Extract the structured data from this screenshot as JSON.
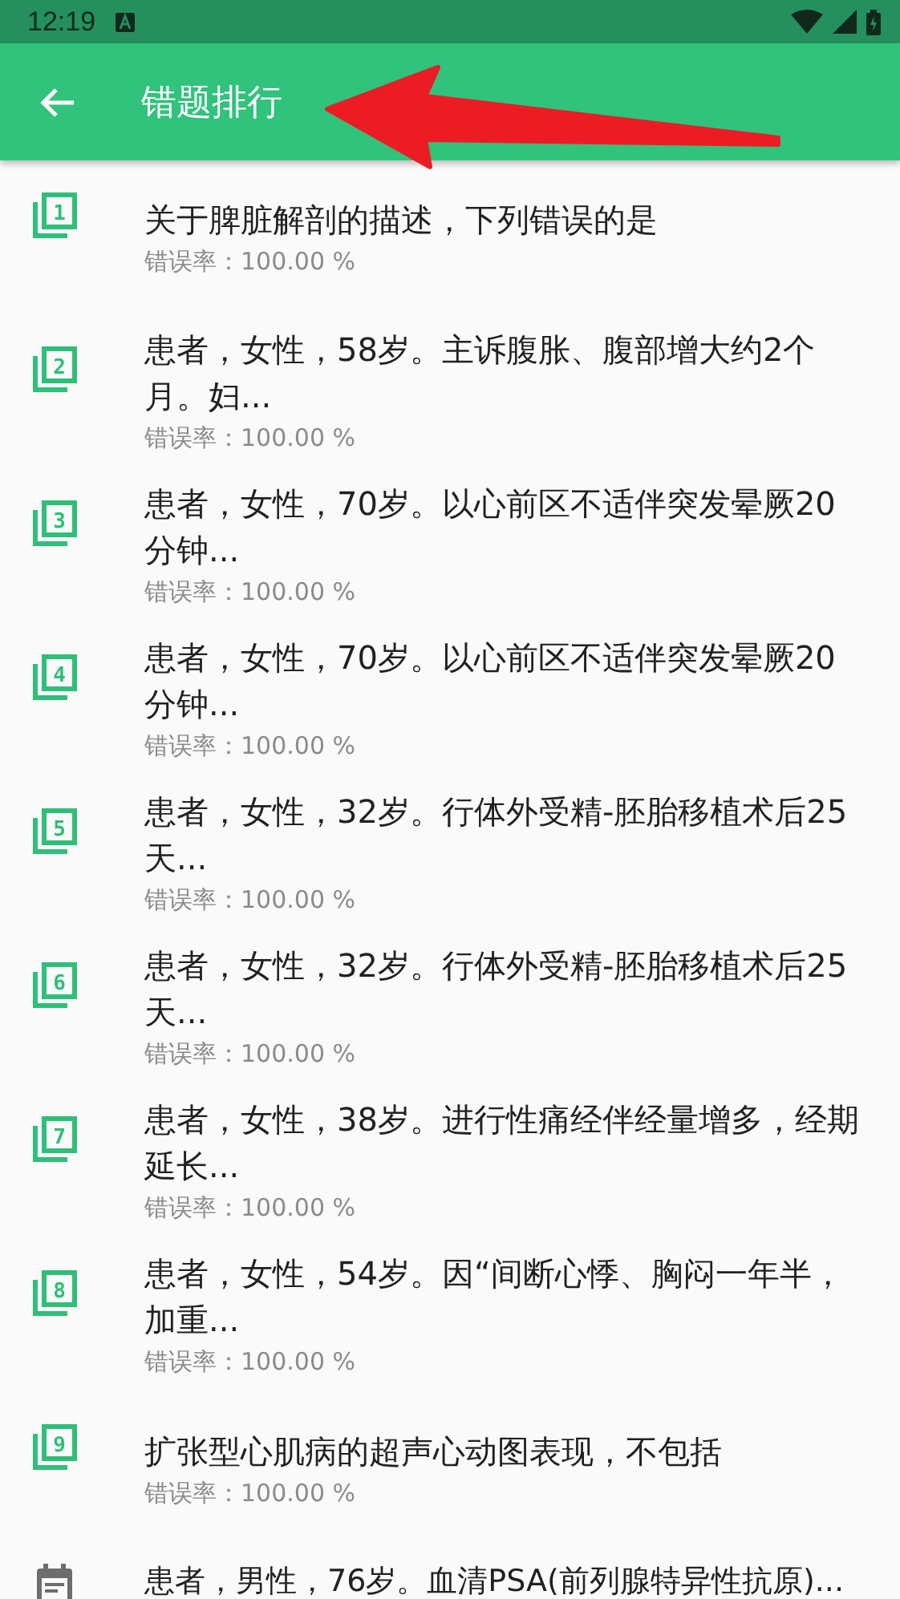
{
  "status_bar": {
    "time": "12:19"
  },
  "app_bar": {
    "title": "错题排行"
  },
  "annotation": {
    "kind": "arrow"
  },
  "items": [
    {
      "kind": "numbered",
      "rank": "1",
      "title": "关于脾脏解剖的描述，下列错误的是",
      "rate": "错误率：100.00 %"
    },
    {
      "kind": "numbered",
      "rank": "2",
      "title": "患者，女性，58岁。主诉腹胀、腹部增大约2个月。妇...",
      "rate": "错误率：100.00 %"
    },
    {
      "kind": "numbered",
      "rank": "3",
      "title": "患者，女性，70岁。以心前区不适伴突发晕厥20分钟...",
      "rate": "错误率：100.00 %"
    },
    {
      "kind": "numbered",
      "rank": "4",
      "title": "患者，女性，70岁。以心前区不适伴突发晕厥20分钟...",
      "rate": "错误率：100.00 %"
    },
    {
      "kind": "numbered",
      "rank": "5",
      "title": "患者，女性，32岁。行体外受精-胚胎移植术后25天...",
      "rate": "错误率：100.00 %"
    },
    {
      "kind": "numbered",
      "rank": "6",
      "title": "患者，女性，32岁。行体外受精-胚胎移植术后25天...",
      "rate": "错误率：100.00 %"
    },
    {
      "kind": "numbered",
      "rank": "7",
      "title": "患者，女性，38岁。进行性痛经伴经量增多，经期延长...",
      "rate": "错误率：100.00 %"
    },
    {
      "kind": "numbered",
      "rank": "8",
      "title": "患者，女性，54岁。因“间断心悸、胸闷一年半，加重...",
      "rate": "错误率：100.00 %"
    },
    {
      "kind": "numbered",
      "rank": "9",
      "title": "扩张型心肌病的超声心动图表现，不包括",
      "rate": "错误率：100.00 %"
    },
    {
      "kind": "calendar",
      "title": "患者，男性，76岁。血清PSA(前列腺特异性抗原)..."
    }
  ]
}
